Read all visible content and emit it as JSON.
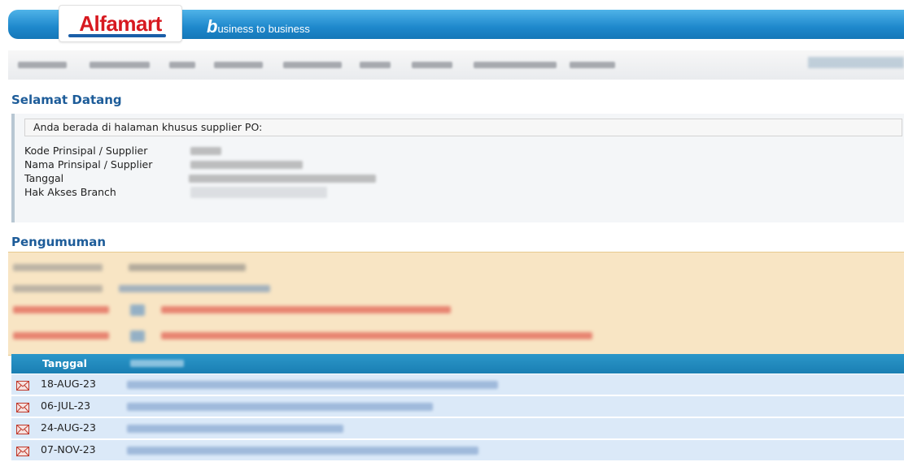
{
  "header": {
    "logo": "Alfamart",
    "tagline_first_letter": "b",
    "tagline_rest": "usiness to business"
  },
  "welcome": {
    "title": "Selamat Datang",
    "intro": "Anda berada di halaman khusus supplier PO:",
    "fields": [
      {
        "label": "Kode Prinsipal / Supplier"
      },
      {
        "label": "Nama Prinsipal / Supplier"
      },
      {
        "label": "Tanggal"
      },
      {
        "label": "Hak Akses Branch"
      }
    ]
  },
  "announcement": {
    "title": "Pengumuman"
  },
  "table": {
    "headers": {
      "date": "Tanggal"
    },
    "rows": [
      {
        "date": "18-AUG-23"
      },
      {
        "date": "06-JUL-23"
      },
      {
        "date": "24-AUG-23"
      },
      {
        "date": "07-NOV-23"
      }
    ]
  },
  "colors": {
    "header_blue": "#1e88cc",
    "title_blue": "#1d5c99",
    "announcement_bg": "#f8e5c4",
    "row_bg": "#dbe9f8",
    "logo_red": "#d71920"
  },
  "icons": {
    "row_icon": "mail-envelope-icon"
  }
}
